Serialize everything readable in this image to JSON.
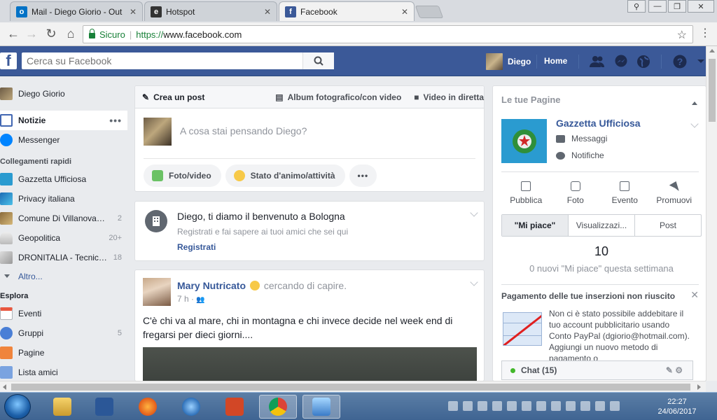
{
  "browser": {
    "tabs": [
      {
        "title": "Mail - Diego Giorio - Out",
        "favicon": "outlook-icon",
        "color": "#0072c6"
      },
      {
        "title": "Hotspot",
        "favicon": "hotspot-icon",
        "color": "#333333"
      },
      {
        "title": "Facebook",
        "favicon": "facebook-icon",
        "color": "#3b5998"
      }
    ],
    "secure_label": "Sicuro",
    "url_scheme": "https://",
    "url_host": "www.facebook.com"
  },
  "fb": {
    "search_placeholder": "Cerca su Facebook",
    "user_name": "Diego",
    "home_label": "Home",
    "colors": {
      "brand": "#3b5998",
      "link": "#365899",
      "bg": "#e9ebee"
    }
  },
  "sidebar": {
    "profile": "Diego Giorio",
    "main": [
      {
        "label": "Notizie",
        "icon": "news-feed-icon",
        "selected": true
      },
      {
        "label": "Messenger",
        "icon": "messenger-icon"
      }
    ],
    "quick_links_header": "Collegamenti rapidi",
    "quick_links": [
      {
        "label": "Gazzetta Ufficiosa",
        "count": "",
        "icon": "page-icon"
      },
      {
        "label": "Privacy italiana",
        "count": "",
        "icon": "page-icon"
      },
      {
        "label": "Comune Di Villanova…",
        "count": "2",
        "icon": "page-icon"
      },
      {
        "label": "Geopolitica",
        "count": "20+",
        "icon": "group-icon"
      },
      {
        "label": "DRONITALIA - Tecnic…",
        "count": "18",
        "icon": "group-icon"
      }
    ],
    "more_label": "Altro...",
    "explore_header": "Esplora",
    "explore": [
      {
        "label": "Eventi",
        "count": "",
        "icon": "calendar-icon"
      },
      {
        "label": "Gruppi",
        "count": "5",
        "icon": "groups-icon"
      },
      {
        "label": "Pagine",
        "count": "",
        "icon": "flag-icon"
      },
      {
        "label": "Lista amici",
        "count": "",
        "icon": "friends-list-icon"
      }
    ]
  },
  "composer": {
    "tabs": [
      "Crea un post",
      "Album fotografico/con video",
      "Video in diretta"
    ],
    "placeholder": "A cosa stai pensando Diego?",
    "actions": [
      "Foto/video",
      "Stato d'animo/attività"
    ]
  },
  "welcome": {
    "title": "Diego, ti diamo il benvenuto a Bologna",
    "subtitle": "Registrati e fai sapere ai tuoi amici che sei qui",
    "link": "Registrati"
  },
  "post": {
    "author": "Mary Nutricato",
    "activity": "cercando di capire.",
    "time": "7 h ·",
    "text": "C'è chi va al mare, chi in montagna e chi invece decide nel week end di fregarsi per dieci giorni...."
  },
  "right": {
    "header": "Le tue Pagine",
    "page_name": "Gazzetta Ufficiosa",
    "messages": "Messaggi",
    "notifications": "Notifiche",
    "actions": [
      "Pubblica",
      "Foto",
      "Evento",
      "Promuovi"
    ],
    "segments": [
      "\"Mi piace\"",
      "Visualizzazi...",
      "Post"
    ],
    "likes_count": "10",
    "likes_text": "0 nuovi \"Mi piace\" questa settimana",
    "payment_title": "Pagamento delle tue inserzioni non riuscito",
    "payment_text": "Non ci è stato possibile addebitare il tuo account pubblicitario usando Conto PayPal (dgiorio@hotmail.com). Aggiungi un nuovo metodo di pagamento o"
  },
  "chat": {
    "label": "Chat (15)"
  },
  "taskbar": {
    "time": "22:27",
    "date": "24/06/2017"
  }
}
